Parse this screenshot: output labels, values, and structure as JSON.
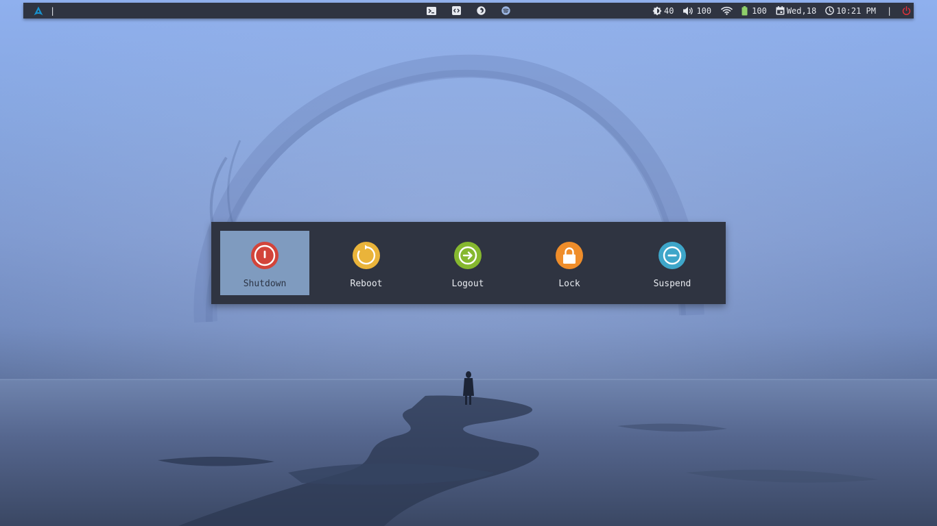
{
  "topbar": {
    "separator": "|",
    "brightness": "40",
    "volume": "100",
    "battery": "100",
    "date": "Wed,18",
    "time": "10:21 PM",
    "launchers": [
      "terminal-icon",
      "code-editor-icon",
      "firefox-icon",
      "spotify-icon"
    ]
  },
  "power_menu": {
    "options": [
      {
        "label": "Shutdown",
        "icon": "power-icon",
        "color": "#d2443a",
        "selected": true
      },
      {
        "label": "Reboot",
        "icon": "reboot-icon",
        "color": "#eab43a",
        "selected": false
      },
      {
        "label": "Logout",
        "icon": "logout-icon",
        "color": "#86b82f",
        "selected": false
      },
      {
        "label": "Lock",
        "icon": "lock-icon",
        "color": "#ef8d2a",
        "selected": false
      },
      {
        "label": "Suspend",
        "icon": "suspend-icon",
        "color": "#3ea6c9",
        "selected": false
      }
    ]
  },
  "colors": {
    "bar_bg": "#2f3441",
    "selected_bg": "#7f9bbf",
    "arch_blue": "#1793d1",
    "power_red": "#e0313a"
  }
}
